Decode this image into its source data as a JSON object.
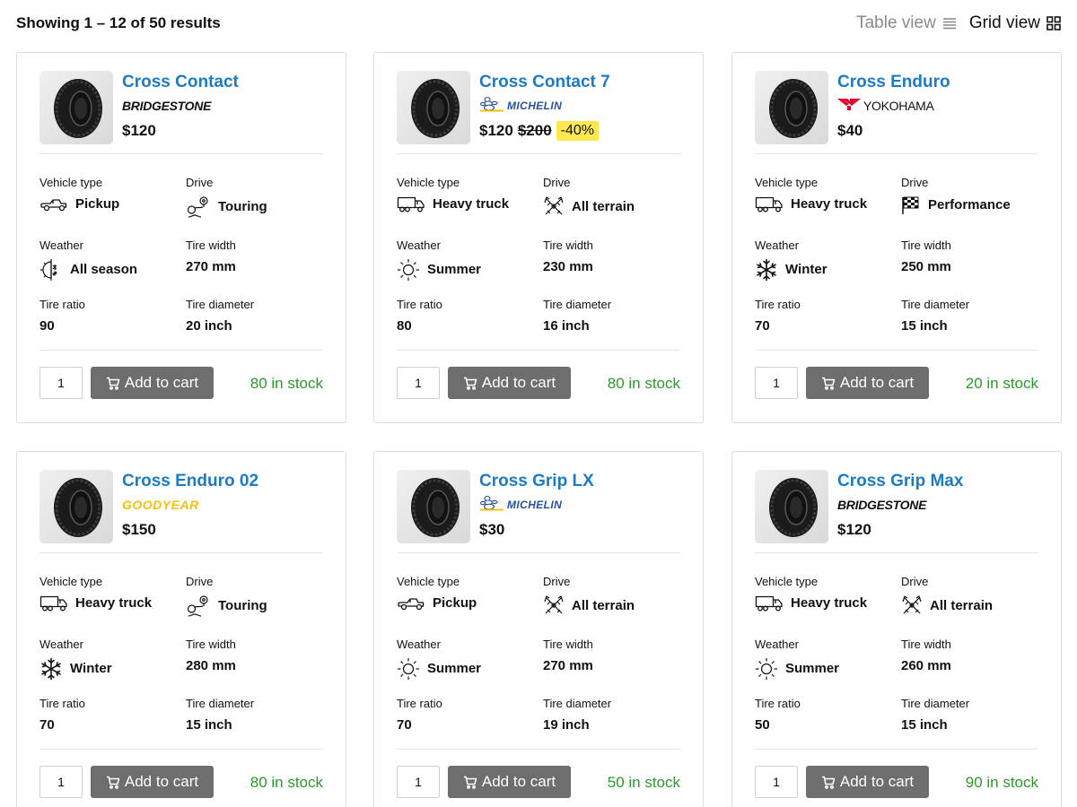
{
  "header": {
    "results_text": "Showing 1 – 12 of 50 results",
    "table_view_label": "Table view",
    "grid_view_label": "Grid view"
  },
  "labels": {
    "vehicle_type": "Vehicle type",
    "drive": "Drive",
    "weather": "Weather",
    "tire_width": "Tire width",
    "tire_ratio": "Tire ratio",
    "tire_diameter": "Tire diameter",
    "add_to_cart": "Add to cart"
  },
  "colors": {
    "title_blue": "#1d7bc4",
    "stock_green": "#2a9a2a",
    "button_gray": "#6e6e6e",
    "discount_yellow": "#ffe84d",
    "michelin_blue": "#27509b",
    "goodyear_yellow": "#f4c20d",
    "yokohama_red": "#e4002b"
  },
  "products": [
    {
      "name": "Cross Contact",
      "brand": "BRIDGESTONE",
      "brand_key": "bridgestone",
      "price": "$120",
      "old_price": "",
      "discount": "",
      "vehicle_type": "Pickup",
      "vehicle_icon": "pickup-icon",
      "drive": "Touring",
      "drive_icon": "touring-icon",
      "weather": "All season",
      "weather_icon": "all-season-icon",
      "tire_width": "270 mm",
      "tire_ratio": "90",
      "tire_diameter": "20 inch",
      "qty": "1",
      "stock": "80 in stock"
    },
    {
      "name": "Cross Contact 7",
      "brand": "MICHELIN",
      "brand_key": "michelin",
      "price": "$120",
      "old_price": "$200",
      "discount": "-40%",
      "vehicle_type": "Heavy truck",
      "vehicle_icon": "truck-icon",
      "drive": "All terrain",
      "drive_icon": "all-terrain-icon",
      "weather": "Summer",
      "weather_icon": "sun-icon",
      "tire_width": "230 mm",
      "tire_ratio": "80",
      "tire_diameter": "16 inch",
      "qty": "1",
      "stock": "80 in stock"
    },
    {
      "name": "Cross Enduro",
      "brand": "YOKOHAMA",
      "brand_key": "yokohama",
      "price": "$40",
      "old_price": "",
      "discount": "",
      "vehicle_type": "Heavy truck",
      "vehicle_icon": "truck-icon",
      "drive": "Performance",
      "drive_icon": "checkered-flag-icon",
      "weather": "Winter",
      "weather_icon": "snowflake-icon",
      "tire_width": "250 mm",
      "tire_ratio": "70",
      "tire_diameter": "15 inch",
      "qty": "1",
      "stock": "20 in stock"
    },
    {
      "name": "Cross Enduro 02",
      "brand": "GOODYEAR",
      "brand_key": "goodyear",
      "price": "$150",
      "old_price": "",
      "discount": "",
      "vehicle_type": "Heavy truck",
      "vehicle_icon": "truck-icon",
      "drive": "Touring",
      "drive_icon": "touring-icon",
      "weather": "Winter",
      "weather_icon": "snowflake-icon",
      "tire_width": "280 mm",
      "tire_ratio": "70",
      "tire_diameter": "15 inch",
      "qty": "1",
      "stock": "80 in stock"
    },
    {
      "name": "Cross Grip LX",
      "brand": "MICHELIN",
      "brand_key": "michelin",
      "price": "$30",
      "old_price": "",
      "discount": "",
      "vehicle_type": "Pickup",
      "vehicle_icon": "pickup-icon",
      "drive": "All terrain",
      "drive_icon": "all-terrain-icon",
      "weather": "Summer",
      "weather_icon": "sun-icon",
      "tire_width": "270 mm",
      "tire_ratio": "70",
      "tire_diameter": "19 inch",
      "qty": "1",
      "stock": "50 in stock"
    },
    {
      "name": "Cross Grip Max",
      "brand": "BRIDGESTONE",
      "brand_key": "bridgestone",
      "price": "$120",
      "old_price": "",
      "discount": "",
      "vehicle_type": "Heavy truck",
      "vehicle_icon": "truck-icon",
      "drive": "All terrain",
      "drive_icon": "all-terrain-icon",
      "weather": "Summer",
      "weather_icon": "sun-icon",
      "tire_width": "260 mm",
      "tire_ratio": "50",
      "tire_diameter": "15 inch",
      "qty": "1",
      "stock": "90 in stock"
    }
  ]
}
